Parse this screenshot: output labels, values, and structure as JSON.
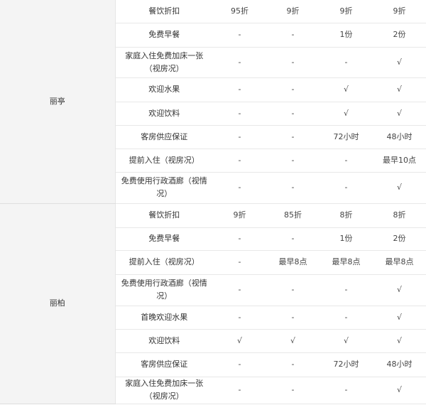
{
  "groups": [
    {
      "brand": "丽亭",
      "rows": [
        {
          "benefit": "餐饮折扣",
          "values": [
            "95折",
            "9折",
            "9折",
            "9折"
          ]
        },
        {
          "benefit": "免费早餐",
          "values": [
            "-",
            "-",
            "1份",
            "2份"
          ]
        },
        {
          "benefit": "家庭入住免费加床一张（视房况）",
          "values": [
            "-",
            "-",
            "-",
            "√"
          ]
        },
        {
          "benefit": "欢迎水果",
          "values": [
            "-",
            "-",
            "√",
            "√"
          ]
        },
        {
          "benefit": "欢迎饮料",
          "values": [
            "-",
            "-",
            "√",
            "√"
          ]
        },
        {
          "benefit": "客房供应保证",
          "values": [
            "-",
            "-",
            "72小时",
            "48小时"
          ]
        },
        {
          "benefit": "提前入住（视房况）",
          "values": [
            "-",
            "-",
            "-",
            "最早10点"
          ]
        },
        {
          "benefit": "免费使用行政酒廊（视情况）",
          "values": [
            "-",
            "-",
            "-",
            "√"
          ]
        }
      ]
    },
    {
      "brand": "丽柏",
      "rows": [
        {
          "benefit": "餐饮折扣",
          "values": [
            "9折",
            "85折",
            "8折",
            "8折"
          ]
        },
        {
          "benefit": "免费早餐",
          "values": [
            "-",
            "-",
            "1份",
            "2份"
          ]
        },
        {
          "benefit": "提前入住（视房况）",
          "values": [
            "-",
            "最早8点",
            "最早8点",
            "最早8点"
          ]
        },
        {
          "benefit": "免费使用行政酒廊（视情况）",
          "values": [
            "-",
            "-",
            "-",
            "√"
          ]
        },
        {
          "benefit": "首晚欢迎水果",
          "values": [
            "-",
            "-",
            "-",
            "√"
          ]
        },
        {
          "benefit": "欢迎饮料",
          "values": [
            "√",
            "√",
            "√",
            "√"
          ]
        },
        {
          "benefit": "客房供应保证",
          "values": [
            "-",
            "-",
            "72小时",
            "48小时"
          ]
        },
        {
          "benefit": "家庭入住免费加床一张（视房况）",
          "values": [
            "-",
            "-",
            "-",
            "√"
          ]
        }
      ]
    }
  ]
}
